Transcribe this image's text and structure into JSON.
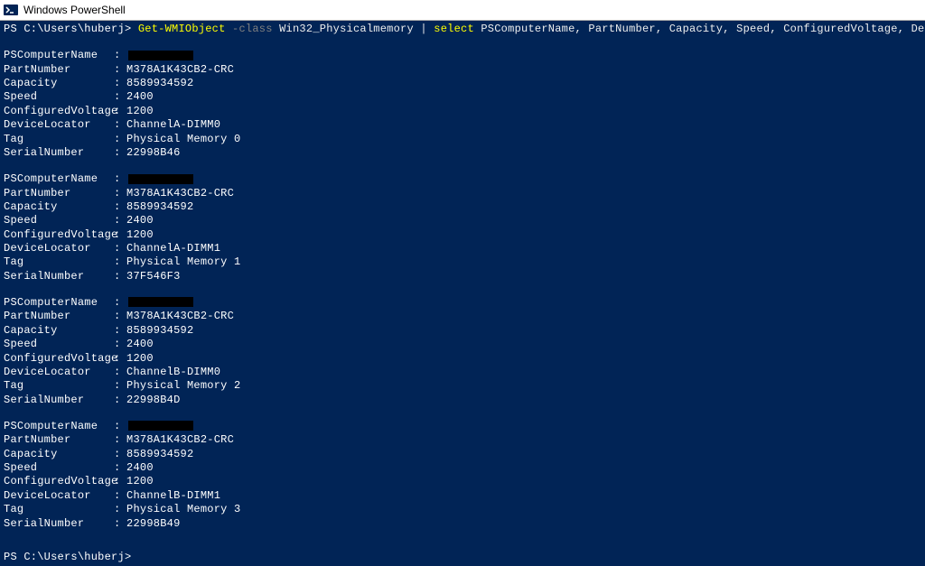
{
  "window": {
    "title": "Windows PowerShell"
  },
  "prompt1": "PS C:\\Users\\huberj> ",
  "prompt2": "PS C:\\Users\\huberj>",
  "command": {
    "cmdlet": "Get-WMIObject",
    "param_flag": " -class ",
    "classname": "Win32_Physicalmemory ",
    "pipe": "| ",
    "select": "select ",
    "fields": "PSComputerName, PartNumber, Capacity, Speed, ConfiguredVoltage, DeviceLocator, Tag, SerialNumber"
  },
  "fields": {
    "pscomputer": "PSComputerName",
    "partnumber": "PartNumber",
    "capacity": "Capacity",
    "speed": "Speed",
    "configvolt": "ConfiguredVoltage",
    "deviceloc": "DeviceLocator",
    "tag": "Tag",
    "serial": "SerialNumber"
  },
  "records": [
    {
      "partnumber": "M378A1K43CB2-CRC",
      "capacity": "8589934592",
      "speed": "2400",
      "configvolt": "1200",
      "deviceloc": "ChannelA-DIMM0",
      "tag": "Physical Memory 0",
      "serial": "22998B46"
    },
    {
      "partnumber": "M378A1K43CB2-CRC",
      "capacity": "8589934592",
      "speed": "2400",
      "configvolt": "1200",
      "deviceloc": "ChannelA-DIMM1",
      "tag": "Physical Memory 1",
      "serial": "37F546F3"
    },
    {
      "partnumber": "M378A1K43CB2-CRC",
      "capacity": "8589934592",
      "speed": "2400",
      "configvolt": "1200",
      "deviceloc": "ChannelB-DIMM0",
      "tag": "Physical Memory 2",
      "serial": "22998B4D"
    },
    {
      "partnumber": "M378A1K43CB2-CRC",
      "capacity": "8589934592",
      "speed": "2400",
      "configvolt": "1200",
      "deviceloc": "ChannelB-DIMM1",
      "tag": "Physical Memory 3",
      "serial": "22998B49"
    }
  ]
}
